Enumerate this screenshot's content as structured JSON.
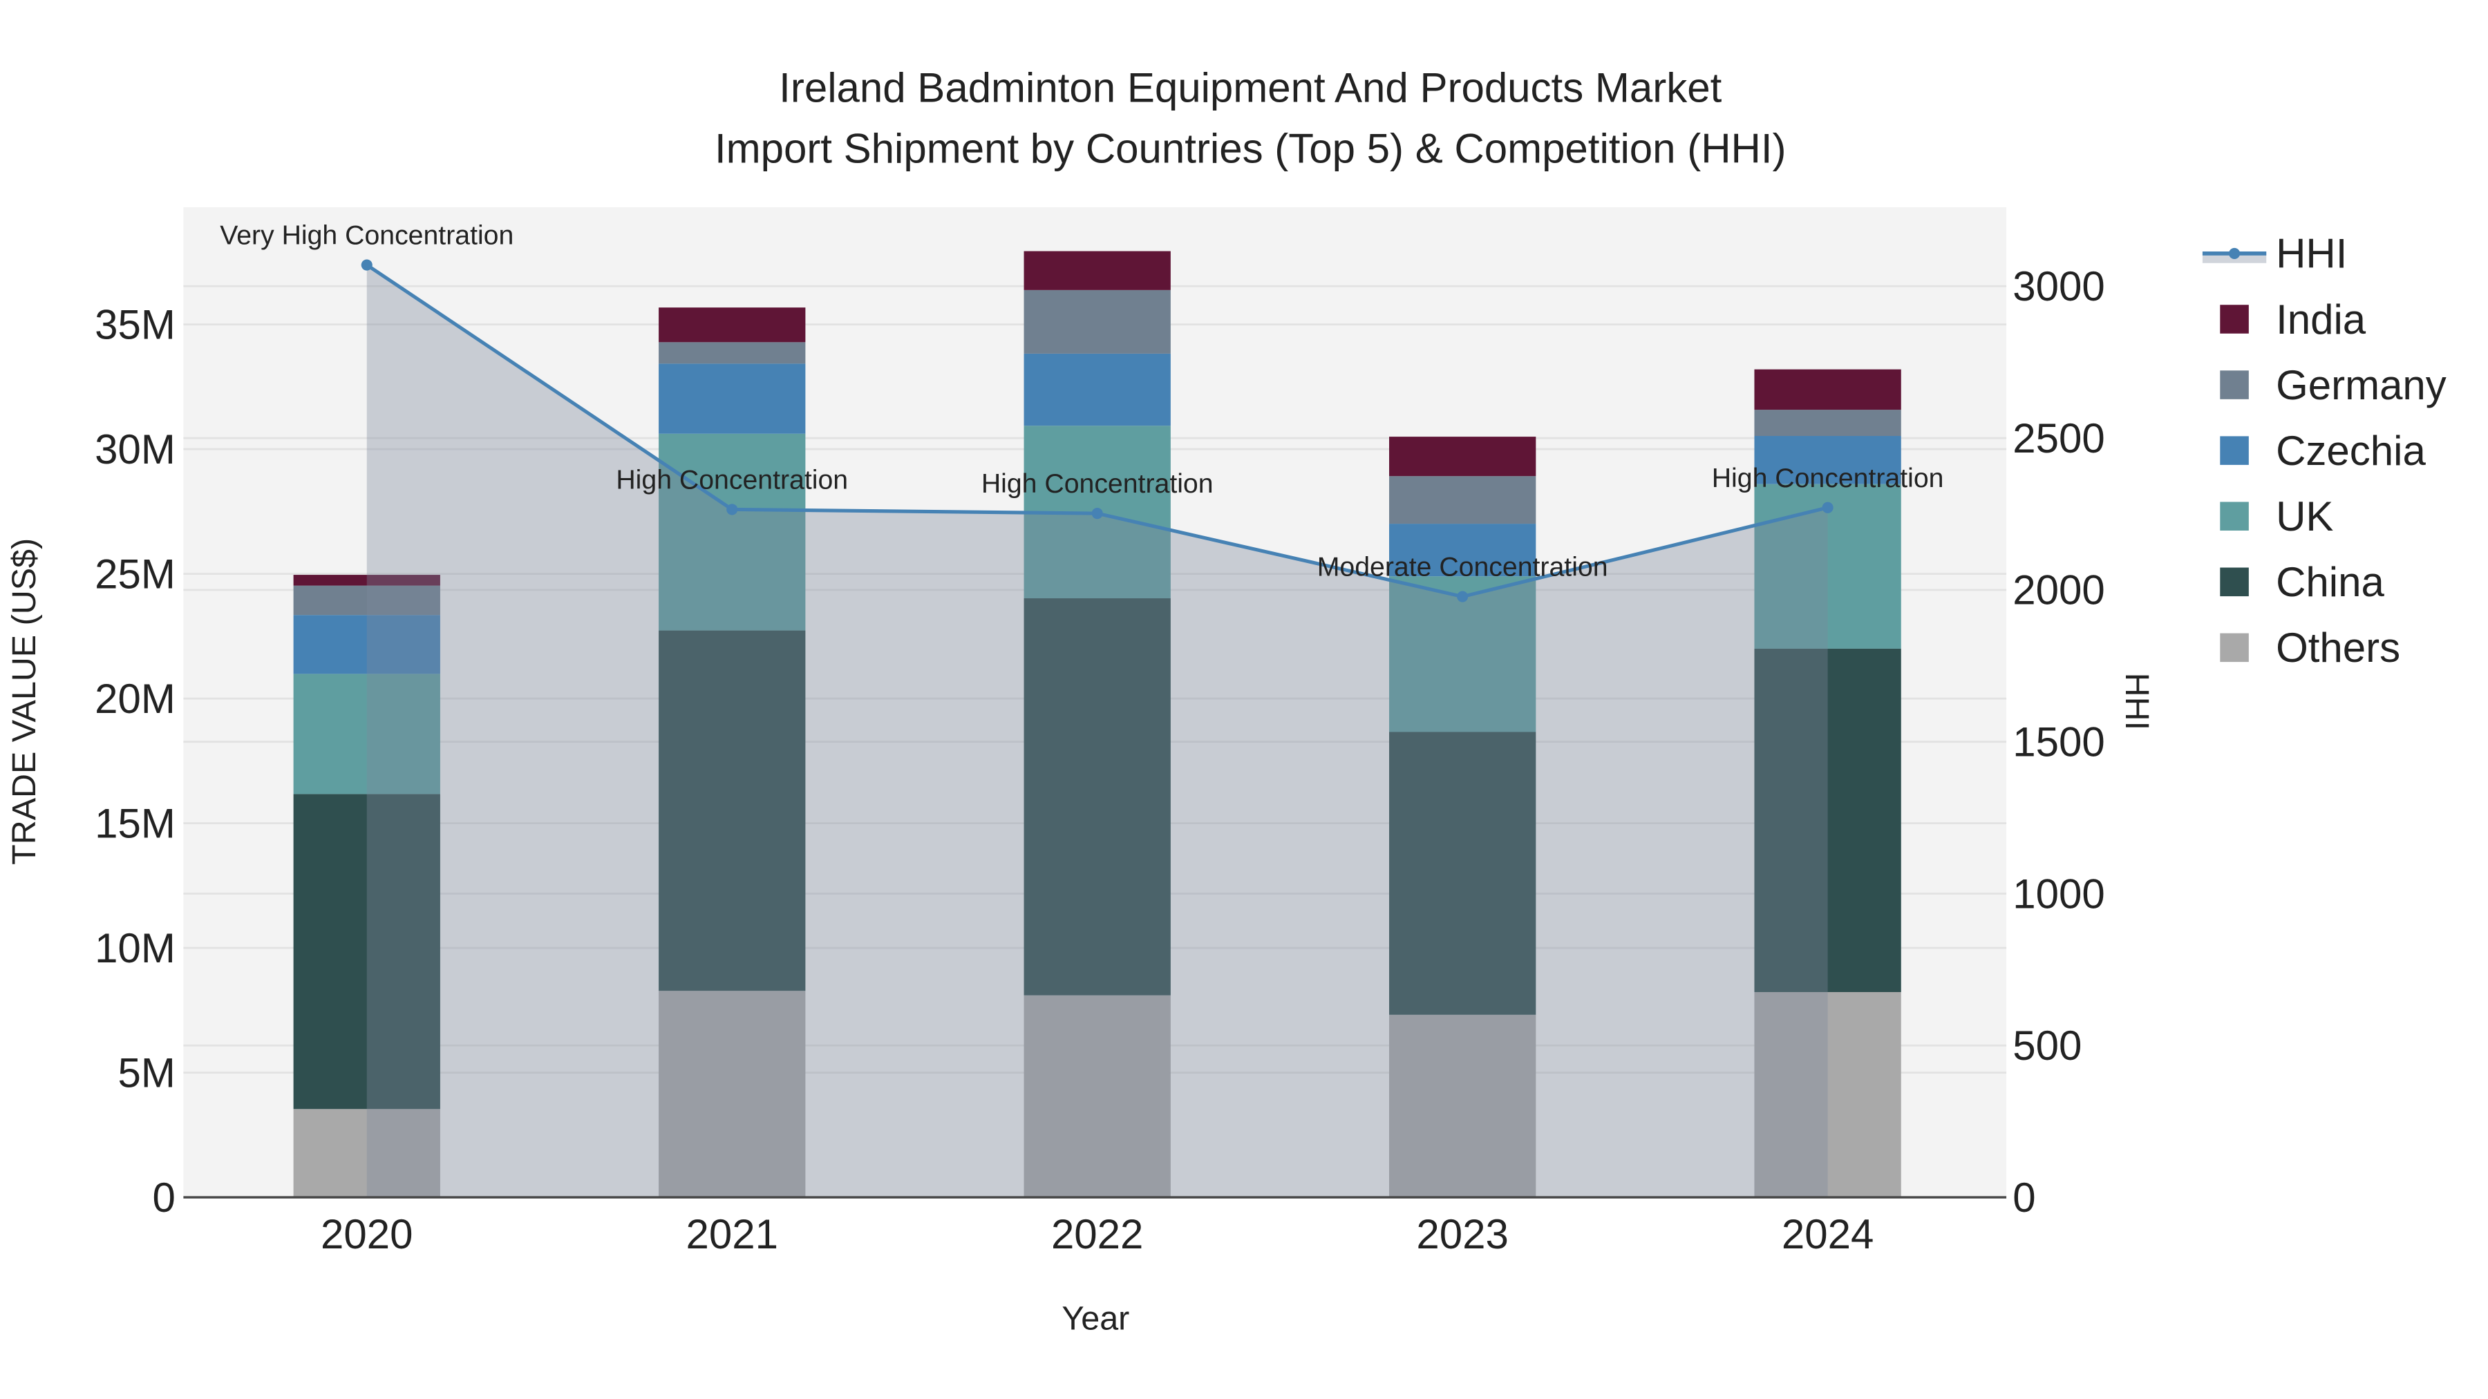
{
  "chart_data": {
    "type": "bar",
    "stacked": true,
    "title": [
      "Ireland Badminton Equipment And Products Market",
      "Import Shipment by Countries (Top 5) & Competition (HHI)"
    ],
    "xlabel": "Year",
    "ylabel": "TRADE VALUE (US$)",
    "y2label": "HHI",
    "categories": [
      "2020",
      "2021",
      "2022",
      "2023",
      "2024"
    ],
    "ylim": [
      0,
      39700000
    ],
    "y2lim": [
      0,
      3260
    ],
    "yticks": [
      0,
      5000000,
      10000000,
      15000000,
      20000000,
      25000000,
      30000000,
      35000000
    ],
    "ytick_labels": [
      "0",
      "5M",
      "10M",
      "15M",
      "20M",
      "25M",
      "30M",
      "35M"
    ],
    "y2ticks": [
      0,
      500,
      1000,
      1500,
      2000,
      2500,
      3000
    ],
    "y2tick_labels": [
      "0",
      "500",
      "1000",
      "1500",
      "2000",
      "2500",
      "3000"
    ],
    "series": [
      {
        "name": "Others",
        "color": "#a9a9a9",
        "values": [
          3540000,
          8280000,
          8100000,
          7320000,
          8230000
        ]
      },
      {
        "name": "China",
        "color": "#2f4f4f",
        "values": [
          12630000,
          14450000,
          15920000,
          11340000,
          13770000
        ]
      },
      {
        "name": "UK",
        "color": "#5f9ea0",
        "values": [
          4820000,
          7890000,
          6920000,
          6240000,
          6600000
        ]
      },
      {
        "name": "Czechia",
        "color": "#4682b4",
        "values": [
          2360000,
          2810000,
          2890000,
          2110000,
          1930000
        ]
      },
      {
        "name": "Germany",
        "color": "#708090",
        "values": [
          1180000,
          860000,
          2550000,
          1910000,
          1050000
        ]
      },
      {
        "name": "India",
        "color": "#5f1536",
        "values": [
          430000,
          1390000,
          1560000,
          1580000,
          1620000
        ]
      }
    ],
    "hhi": {
      "name": "HHI",
      "color": "#4682b4",
      "values": [
        3070,
        2265,
        2252,
        1978,
        2271
      ]
    },
    "annotations": [
      "Very High Concentration",
      "High Concentration",
      "High Concentration",
      "Moderate Concentration",
      "High Concentration"
    ],
    "legend": [
      "HHI",
      "India",
      "Germany",
      "Czechia",
      "UK",
      "China",
      "Others"
    ],
    "legend_placement": "right",
    "grid": true
  }
}
